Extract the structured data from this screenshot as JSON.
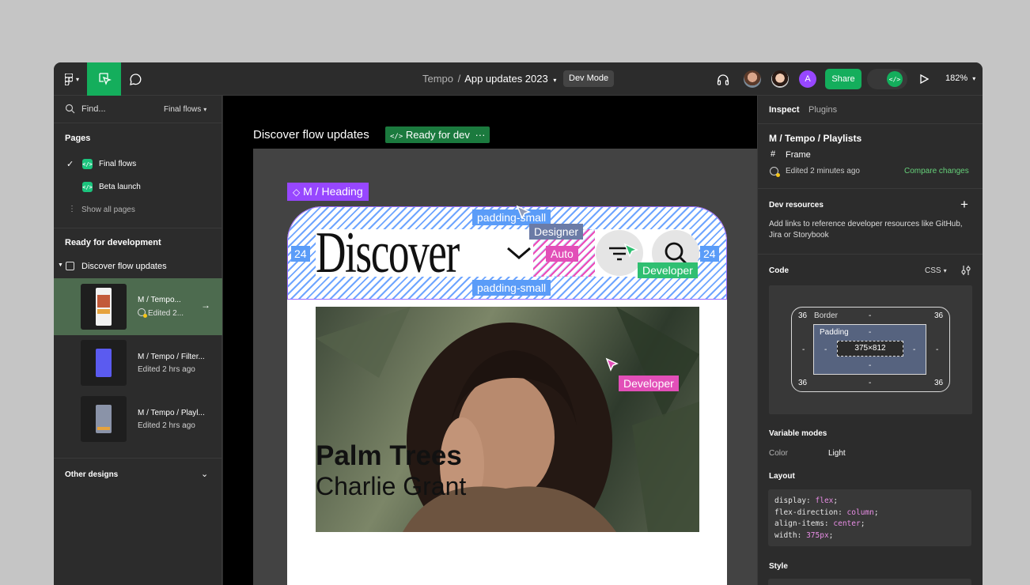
{
  "topbar": {
    "project": "Tempo",
    "separator": "/",
    "file": "App updates 2023",
    "mode_badge": "Dev Mode",
    "share_label": "Share",
    "avatar_letter": "A",
    "zoom": "182%"
  },
  "left": {
    "find_placeholder": "Find...",
    "page_filter": "Final flows",
    "pages_header": "Pages",
    "pages": [
      "Final flows",
      "Beta launch"
    ],
    "show_all": "Show all pages",
    "ready_header": "Ready for development",
    "section_name": "Discover flow updates",
    "items": [
      {
        "title": "M / Tempo...",
        "meta": "Edited 2..."
      },
      {
        "title": "M / Tempo / Filter...",
        "meta": "Edited 2 hrs ago"
      },
      {
        "title": "M / Tempo / Playl...",
        "meta": "Edited 2 hrs ago"
      }
    ],
    "other_header": "Other designs"
  },
  "canvas": {
    "frame_title": "Discover flow updates",
    "ready_badge": "Ready for dev",
    "designer_label": "Designer",
    "developer_label": "Developer",
    "developer_label2": "Developer",
    "component_label": "M / Heading",
    "padding_top": "padding-small",
    "padding_bottom": "padding-small",
    "left_num": "24",
    "right_num": "24",
    "auto_label": "Auto",
    "heading_text": "Discover",
    "card_title": "Palm Trees",
    "card_sub": "Charlie Grant"
  },
  "right": {
    "tabs": [
      "Inspect",
      "Plugins"
    ],
    "component_path": "M / Tempo / Playlists",
    "frame_label": "Frame",
    "edited": "Edited 2 minutes ago",
    "compare": "Compare changes",
    "dev_resources_header": "Dev resources",
    "dev_resources_text": "Add links to reference developer resources like GitHub, Jira or Storybook",
    "code_header": "Code",
    "code_lang": "CSS",
    "box": {
      "border_label": "Border",
      "padding_label": "Padding",
      "size": "375×812",
      "corner": "36",
      "dash": "-"
    },
    "variable_modes_header": "Variable modes",
    "color_label": "Color",
    "color_value": "Light",
    "layout_header": "Layout",
    "layout_code": [
      {
        "prop": "display",
        "val": "flex"
      },
      {
        "prop": "flex-direction",
        "val": "column"
      },
      {
        "prop": "align-items",
        "val": "center"
      },
      {
        "prop": "width",
        "val": "375px"
      }
    ],
    "style_header": "Style"
  },
  "colors": {
    "accent_green": "#1bc47d",
    "figma_green": "#14ae5c",
    "measure_blue": "#5a9cf8",
    "auto_pink": "#e24fb8",
    "component_purple": "#9747ff",
    "designer_tag": "#6b7ba6"
  }
}
